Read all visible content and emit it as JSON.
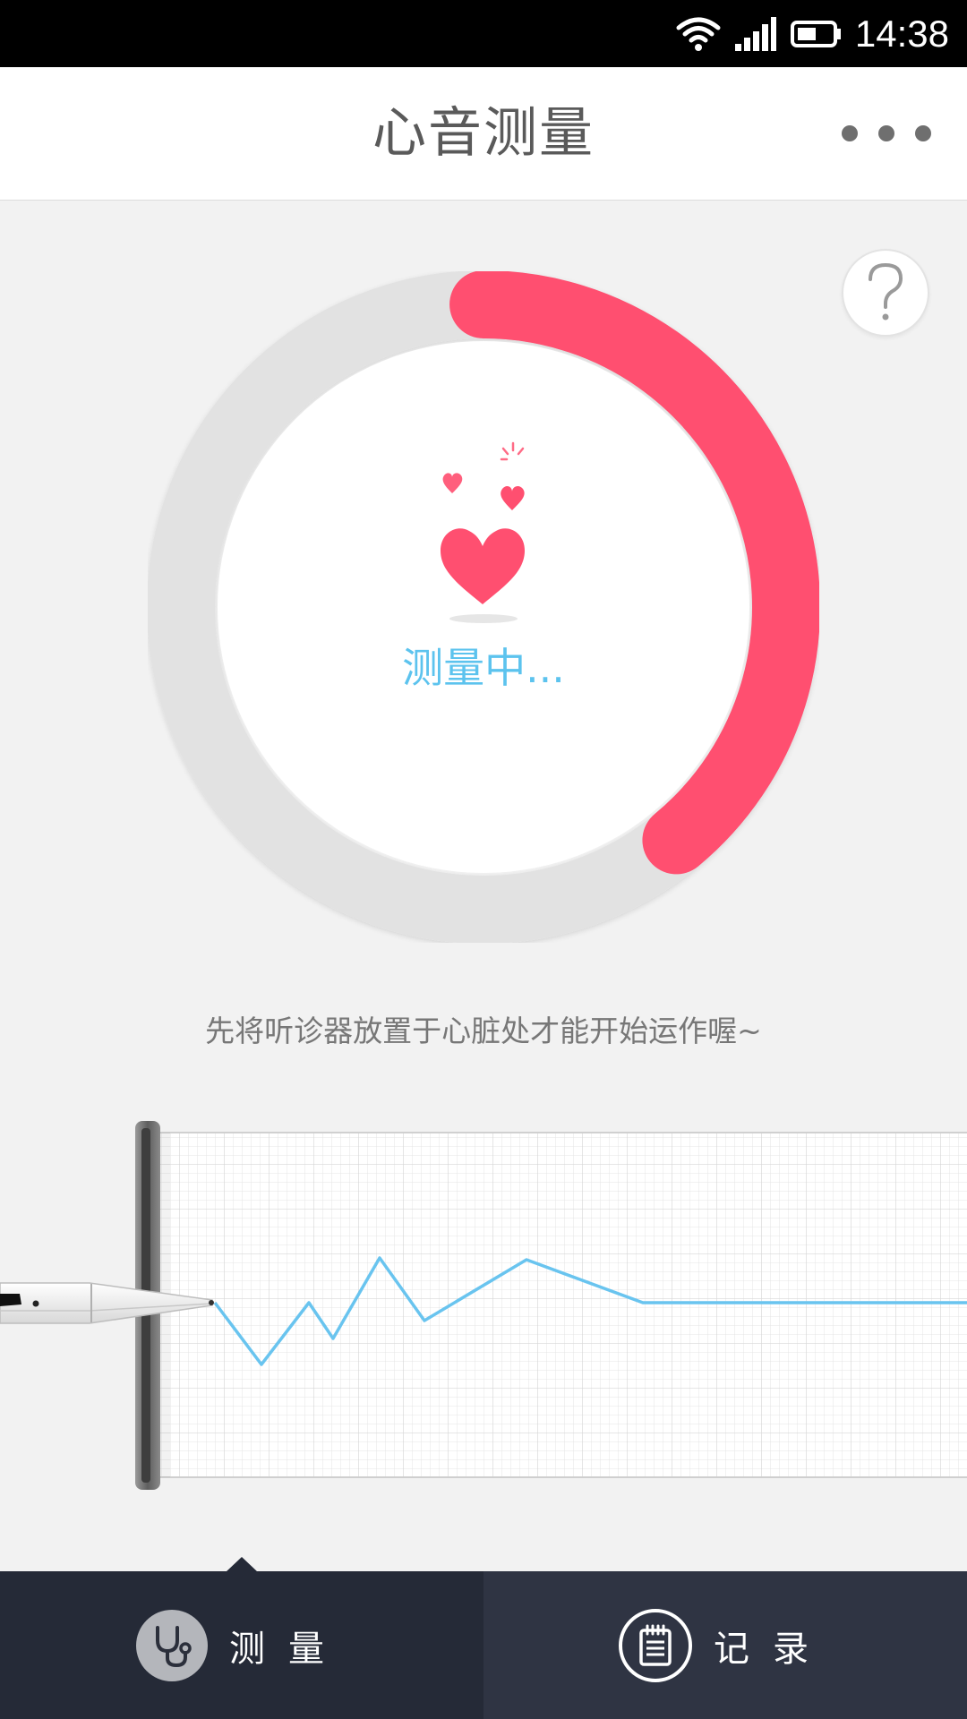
{
  "status_bar": {
    "time": "14:38"
  },
  "header": {
    "title": "心音测量"
  },
  "gauge": {
    "progress_percent": 39,
    "status_text": "测量中..."
  },
  "hint": "先将听诊器放置于心脏处才能开始运作喔~",
  "tabs": [
    {
      "label": "测量",
      "active": true
    },
    {
      "label": "记录",
      "active": false
    }
  ],
  "colors": {
    "accent_red": "#ff4f70",
    "accent_blue": "#5cc3ee",
    "tab_bg": "#252a37"
  }
}
